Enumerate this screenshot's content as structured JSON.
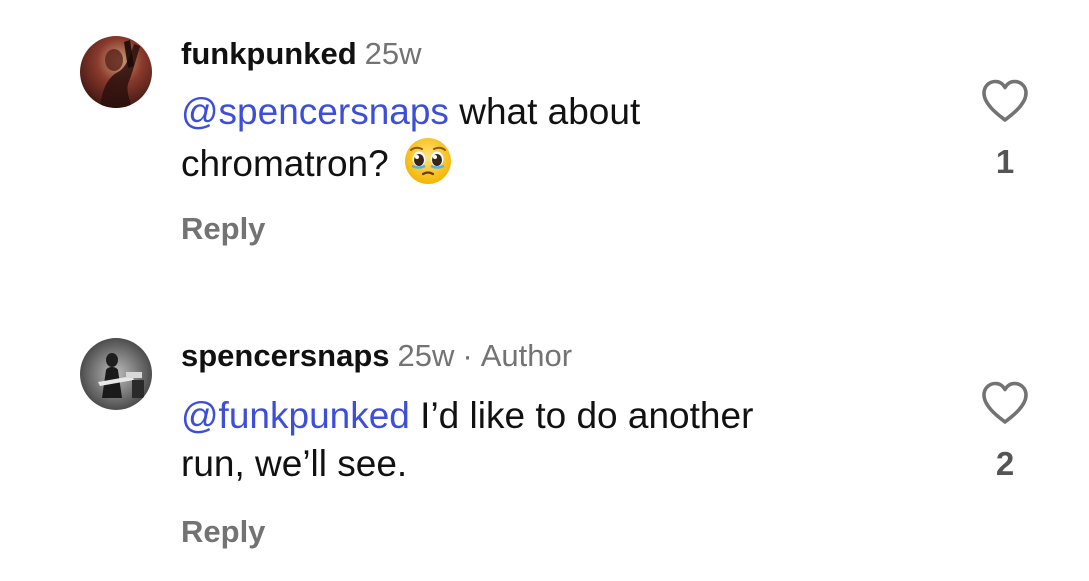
{
  "comments": [
    {
      "username": "funkpunked",
      "timestamp": "25w",
      "mention": "@spencersnaps",
      "text_line1": " what about",
      "text_line2": "chromatron?",
      "emoji": "pleading-face-icon",
      "reply_label": "Reply",
      "like_count": "1"
    },
    {
      "username": "spencersnaps",
      "timestamp": "25w",
      "separator": "·",
      "author_label": "Author",
      "mention": "@funkpunked",
      "text_line1": " I’d like to do another",
      "text_line2": "run, we’ll see.",
      "reply_label": "Reply",
      "like_count": "2"
    }
  ],
  "colors": {
    "mention": "#3d4fd8",
    "secondary_text": "#737373",
    "primary_text": "#111111"
  }
}
